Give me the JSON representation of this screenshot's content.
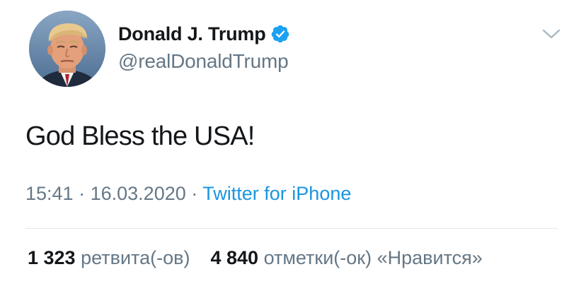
{
  "tweet": {
    "author": {
      "display_name": "Donald J. Trump",
      "handle": "@realDonaldTrump",
      "verified": true,
      "avatar_icon": "profile-photo-avatar"
    },
    "text": "God Bless the USA!",
    "time": "15:41",
    "date": "16.03.2020",
    "separator": "·",
    "source": "Twitter for iPhone",
    "stats": {
      "retweets_count": "1 323",
      "retweets_label": "ретвита(-ов)",
      "likes_count": "4 840",
      "likes_label": "отметки(-ок) «Нравится»"
    },
    "icons": {
      "verified": "verified-badge-icon",
      "menu": "chevron-down-icon"
    },
    "colors": {
      "text": "#14171a",
      "secondary": "#657786",
      "link": "#1b95e0",
      "divider": "#e1e8ed",
      "verified_badge": "#1da1f2"
    }
  }
}
